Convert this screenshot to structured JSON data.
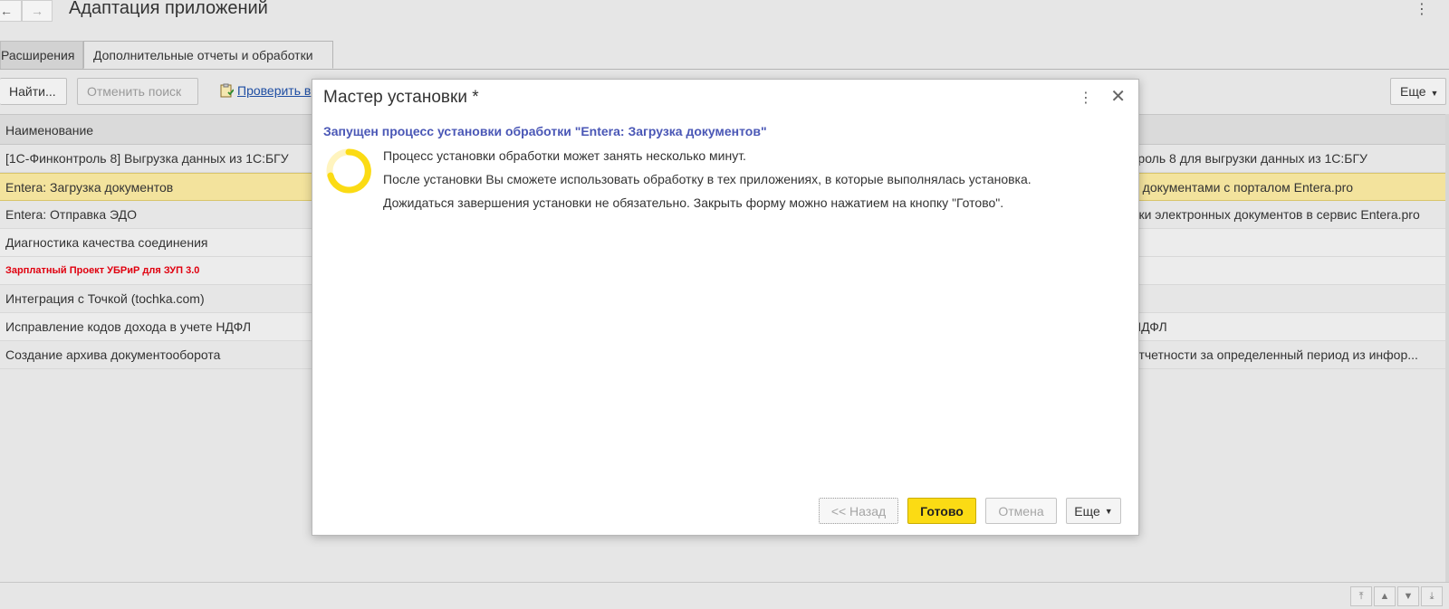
{
  "window": {
    "title": "Адаптация приложений",
    "back_icon": "←",
    "forward_icon": "→",
    "menu_icon": "⋮"
  },
  "tabs": [
    {
      "label": "Расширения"
    },
    {
      "label": "Дополнительные отчеты и обработки"
    }
  ],
  "toolbar": {
    "find_label": "Найти...",
    "cancel_search_label": "Отменить поиск",
    "check_link_label": "Проверить в",
    "more_label": "Еще"
  },
  "grid": {
    "column_name": "Наименование",
    "rows": [
      {
        "name": "[1С-Финконтроль 8] Выгрузка данных из 1С:БГУ",
        "description": "троль 8 для выгрузки данных из 1С:БГУ"
      },
      {
        "name": "Entera: Загрузка документов",
        "description": "а документами с порталом Entera.pro"
      },
      {
        "name": "Entera: Отправка ЭДО",
        "description": "вки электронных документов в сервис Entera.pro"
      },
      {
        "name": "Диагностика качества соединения",
        "description": ""
      },
      {
        "name": "Зарплатный Проект УБРиР для ЗУП 3.0",
        "description": ""
      },
      {
        "name": "Интеграция с Точкой (tochka.com)",
        "description": ""
      },
      {
        "name": "Исправление кодов дохода в учете НДФЛ",
        "description": "НДФЛ"
      },
      {
        "name": "Создание архива документооборота",
        "description": "отчетности за определенный период из инфор..."
      }
    ]
  },
  "dialog": {
    "title": "Мастер установки *",
    "subtitle": "Запущен процесс установки обработки \"Entera: Загрузка документов\"",
    "messages": [
      "Процесс установки обработки может занять несколько минут.",
      "После установки Вы сможете использовать обработку в тех приложениях, в которые выполнялась установка.",
      "Дожидаться завершения установки не обязательно. Закрыть форму можно нажатием на кнопку \"Готово\"."
    ],
    "buttons": {
      "back": "<< Назад",
      "done": "Готово",
      "cancel": "Отмена",
      "more": "Еще"
    },
    "accent_color": "#fbdb14",
    "link_color": "#4a57b6"
  },
  "colors": {
    "selected_row": "#f3e39d",
    "red_text": "#e0000f"
  }
}
